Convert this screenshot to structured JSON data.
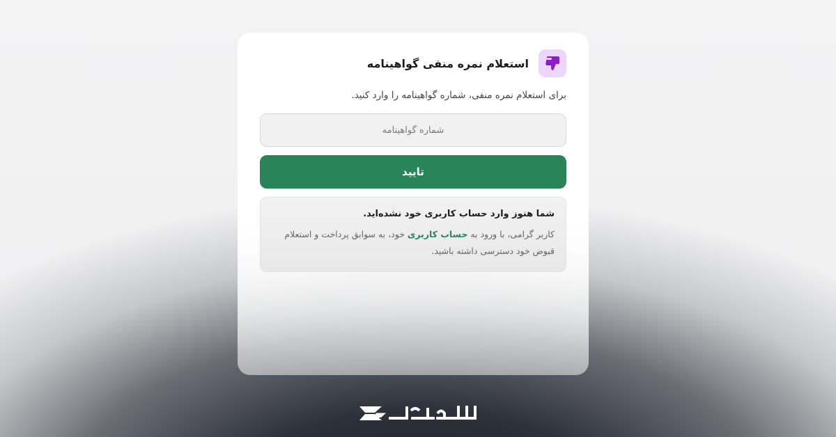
{
  "card": {
    "title": "استعلام نمره منفی گواهینامه",
    "icon": "thumbs-down-icon",
    "icon_bg": "#ecd6fb",
    "description": "برای استعلام نمره منفی، شماره گواهینامه را وارد کنید.",
    "input": {
      "placeholder": "شماره گواهینامه",
      "value": ""
    },
    "submit_label": "تایید",
    "accent_color": "#2a8459"
  },
  "notice": {
    "title": "شما هنوز وارد حساب کاربری خود نشده‌اید.",
    "body_before": "کاربر گرامی، با ورود به",
    "link_label": "حساب کاربری",
    "body_after": "خود، به سوابق پرداخت و استعلام قبوض خود دسترسی داشته باشید."
  },
  "brand": {
    "logo": "payapak-logo"
  }
}
